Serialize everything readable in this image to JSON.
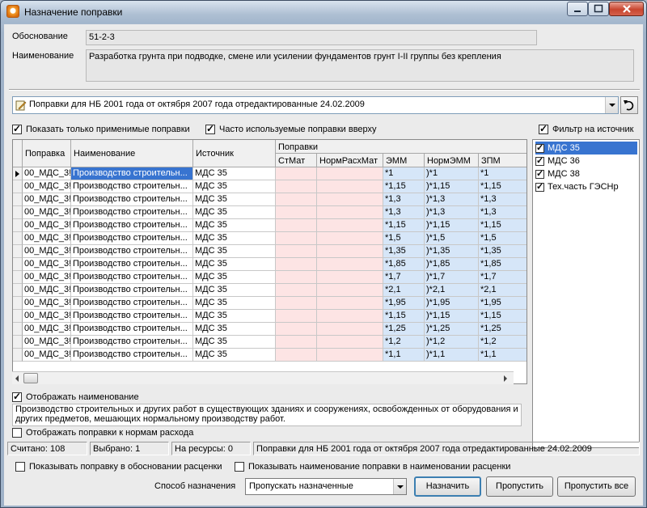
{
  "window": {
    "title": "Назначение поправки"
  },
  "basis": {
    "label": "Обоснование",
    "value": "51-2-3"
  },
  "name": {
    "label": "Наименование",
    "value": "Разработка грунта при подводке, смене или усилении фундаментов грунт I-II группы без крепления"
  },
  "corrections_combo": {
    "value": "Поправки  для НБ 2001 года от октября 2007 года  отредактированные 24.02.2009"
  },
  "checks": {
    "only_applicable": {
      "label": "Показать только применимые поправки",
      "checked": true
    },
    "frequent_top": {
      "label": "Часто используемые поправки вверху",
      "checked": true
    },
    "source_filter": {
      "label": "Фильтр на источник",
      "checked": true
    },
    "show_name": {
      "label": "Отображать наименование",
      "checked": true
    },
    "show_norms": {
      "label": "Отображать поправки к нормам расхода",
      "checked": false
    },
    "show_in_basis": {
      "label": "Показывать поправку в обосновании расценки",
      "checked": false
    },
    "show_in_name": {
      "label": "Показывать наименование поправки в наименовании расценки",
      "checked": false
    }
  },
  "grid": {
    "columns": {
      "correction": "Поправка",
      "name": "Наименование",
      "source": "Источник",
      "group": "Поправки",
      "stmat": "СтМат",
      "normrasxmat": "НормРасхМат",
      "emm": "ЭММ",
      "normemm": "НормЭММ",
      "zpm": "ЗПМ"
    },
    "rows": [
      {
        "code": "00_МДС_3!",
        "name": "Производство строительн...",
        "source": "МДС 35",
        "emm": "*1",
        "normemm": ")*1",
        "zpm": "*1"
      },
      {
        "code": "00_МДС_3!",
        "name": "Производство строительн...",
        "source": "МДС 35",
        "emm": "*1,15",
        "normemm": ")*1,15",
        "zpm": "*1,15"
      },
      {
        "code": "00_МДС_3!",
        "name": "Производство строительн...",
        "source": "МДС 35",
        "emm": "*1,3",
        "normemm": ")*1,3",
        "zpm": "*1,3"
      },
      {
        "code": "00_МДС_3!",
        "name": "Производство строительн...",
        "source": "МДС 35",
        "emm": "*1,3",
        "normemm": ")*1,3",
        "zpm": "*1,3"
      },
      {
        "code": "00_МДС_3!",
        "name": "Производство строительн...",
        "source": "МДС 35",
        "emm": "*1,15",
        "normemm": ")*1,15",
        "zpm": "*1,15"
      },
      {
        "code": "00_МДС_3!",
        "name": "Производство строительн...",
        "source": "МДС 35",
        "emm": "*1,5",
        "normemm": ")*1,5",
        "zpm": "*1,5"
      },
      {
        "code": "00_МДС_3!",
        "name": "Производство строительн...",
        "source": "МДС 35",
        "emm": "*1,35",
        "normemm": ")*1,35",
        "zpm": "*1,35"
      },
      {
        "code": "00_МДС_3!",
        "name": "Производство строительн...",
        "source": "МДС 35",
        "emm": "*1,85",
        "normemm": ")*1,85",
        "zpm": "*1,85"
      },
      {
        "code": "00_МДС_3!",
        "name": "Производство строительн...",
        "source": "МДС 35",
        "emm": "*1,7",
        "normemm": ")*1,7",
        "zpm": "*1,7"
      },
      {
        "code": "00_МДС_3!",
        "name": "Производство строительн...",
        "source": "МДС 35",
        "emm": "*2,1",
        "normemm": ")*2,1",
        "zpm": "*2,1"
      },
      {
        "code": "00_МДС_3!",
        "name": "Производство строительн...",
        "source": "МДС 35",
        "emm": "*1,95",
        "normemm": ")*1,95",
        "zpm": "*1,95"
      },
      {
        "code": "00_МДС_3!",
        "name": "Производство строительн...",
        "source": "МДС 35",
        "emm": "*1,15",
        "normemm": ")*1,15",
        "zpm": "*1,15"
      },
      {
        "code": "00_МДС_3!",
        "name": "Производство строительн...",
        "source": "МДС 35",
        "emm": "*1,25",
        "normemm": ")*1,25",
        "zpm": "*1,25"
      },
      {
        "code": "00_МДС_3!",
        "name": "Производство строительн...",
        "source": "МДС 35",
        "emm": "*1,2",
        "normemm": ")*1,2",
        "zpm": "*1,2"
      },
      {
        "code": "00_МДС_3!",
        "name": "Производство строительн...",
        "source": "МДС 35",
        "emm": "*1,1",
        "normemm": ")*1,1",
        "zpm": "*1,1"
      }
    ]
  },
  "sources": [
    {
      "label": "МДС 35",
      "checked": true,
      "selected": true
    },
    {
      "label": "МДС 36",
      "checked": true,
      "selected": false
    },
    {
      "label": "МДС 38",
      "checked": true,
      "selected": false
    },
    {
      "label": "Тех.часть ГЭСНр",
      "checked": true,
      "selected": false
    }
  ],
  "description": "Производство строительных и других работ в существующих зданиях и сооружениях, освобожденных от оборудования и других предметов, мешающих нормальному производству работ.",
  "status": {
    "counted": "Считано: 108",
    "selected": "Выбрано: 1",
    "on_resources": "На ресурсы: 0",
    "set": "Поправки  для НБ 2001 года от октября 2007 года  отредактированные 24.02.2009"
  },
  "assign": {
    "label": "Способ назначения",
    "value": "Пропускать назначенные"
  },
  "buttons": {
    "assign": "Назначить",
    "skip": "Пропустить",
    "skip_all": "Пропустить все"
  }
}
